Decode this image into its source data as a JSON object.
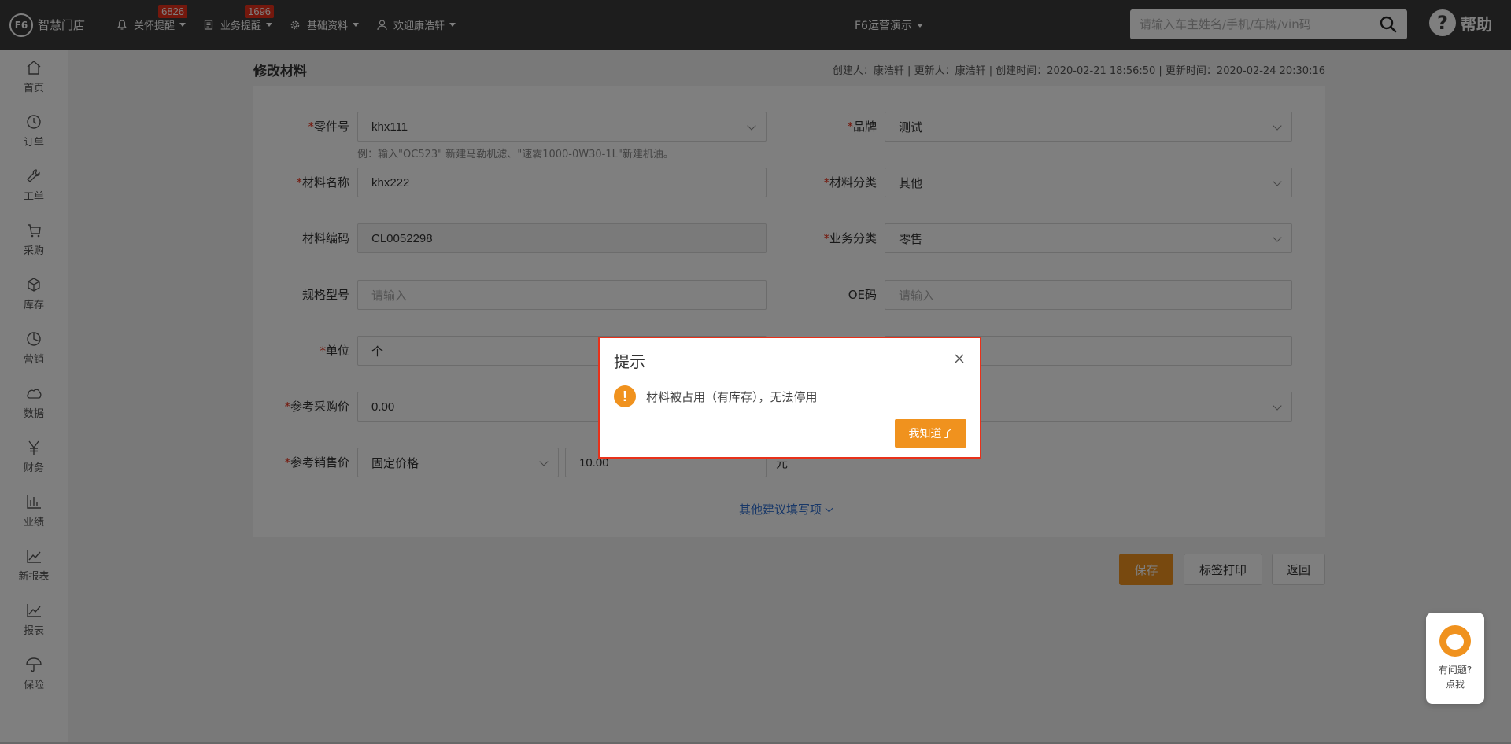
{
  "app": {
    "logo_mark": "F6",
    "logo_text": "智慧门店"
  },
  "topnav": {
    "items": [
      {
        "label": "关怀提醒",
        "badge": "6826",
        "icon": "bell-icon"
      },
      {
        "label": "业务提醒",
        "badge": "1696",
        "icon": "document-icon"
      },
      {
        "label": "基础资料",
        "icon": "gear-icon"
      },
      {
        "label": "欢迎康浩轩",
        "icon": "user-icon"
      }
    ],
    "store": "F6运营演示",
    "search_placeholder": "请输入车主姓名/手机/车牌/vin码",
    "help_label": "帮助"
  },
  "sidebar": {
    "items": [
      {
        "label": "首页",
        "icon": "home-icon"
      },
      {
        "label": "订单",
        "icon": "clock-icon"
      },
      {
        "label": "工单",
        "icon": "wrench-icon"
      },
      {
        "label": "采购",
        "icon": "cart-icon"
      },
      {
        "label": "库存",
        "icon": "box-icon"
      },
      {
        "label": "营销",
        "icon": "pie-icon"
      },
      {
        "label": "数据",
        "icon": "cloud-icon"
      },
      {
        "label": "财务",
        "icon": "yen-icon"
      },
      {
        "label": "业绩",
        "icon": "bar-chart-icon"
      },
      {
        "label": "新报表",
        "icon": "line-chart-icon"
      },
      {
        "label": "报表",
        "icon": "line-chart-icon"
      },
      {
        "label": "保险",
        "icon": "umbrella-icon"
      }
    ]
  },
  "page": {
    "title": "修改材料",
    "meta": "创建人：康浩轩 | 更新人：康浩轩 | 创建时间：2020-02-21 18:56:50 | 更新时间：2020-02-24 20:30:16"
  },
  "form": {
    "part_no": {
      "label": "零件号",
      "value": "khx111",
      "hint": "例：输入\"OC523\" 新建马勒机滤、\"速霸1000-0W30-1L\"新建机油。"
    },
    "brand": {
      "label": "品牌",
      "value": "测试"
    },
    "material_name": {
      "label": "材料名称",
      "value": "khx222"
    },
    "material_category": {
      "label": "材料分类",
      "value": "其他"
    },
    "material_code": {
      "label": "材料编码",
      "value": "CL0052298"
    },
    "business_category": {
      "label": "业务分类",
      "value": "零售"
    },
    "spec": {
      "label": "规格型号",
      "placeholder": "请输入"
    },
    "oe_code": {
      "label": "OE码",
      "placeholder": "请输入"
    },
    "unit": {
      "label": "单位",
      "value": "个"
    },
    "ref_purchase_price": {
      "label": "参考采购价",
      "value": "0.00"
    },
    "ref_sale_price": {
      "label": "参考销售价",
      "mode": "固定价格",
      "value": "10.00",
      "unit": "元"
    },
    "more_link": "其他建议填写项"
  },
  "actions": {
    "save": "保存",
    "print_label": "标签打印",
    "back": "返回"
  },
  "chat": {
    "line1": "有问题?",
    "line2": "点我"
  },
  "dialog": {
    "title": "提示",
    "icon_glyph": "!",
    "message": "材料被占用（有库存），无法停用",
    "confirm": "我知道了"
  },
  "colors": {
    "accent": "#f0921e",
    "topbar": "#3a3a3a",
    "danger": "#e8311a",
    "link": "#2f6fd0"
  }
}
